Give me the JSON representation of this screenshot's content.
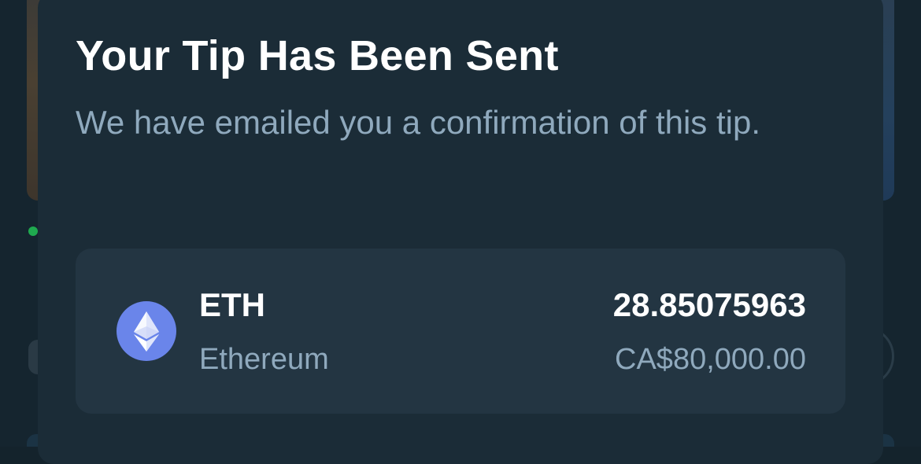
{
  "modal": {
    "title": "Your Tip Has Been Sent",
    "message": "We have emailed you a confirmation of this tip."
  },
  "tip": {
    "currency_symbol": "ETH",
    "currency_name": "Ethereum",
    "icon": "ethereum-icon",
    "amount": "28.85075963",
    "fiat_value": "CA$80,000.00"
  },
  "colors": {
    "sheet_background": "#1b2c37",
    "card_background": "#233542",
    "primary_text": "#ffffff",
    "secondary_text": "#8fa9bd",
    "ethereum_icon_bg": "#6a85ea"
  }
}
